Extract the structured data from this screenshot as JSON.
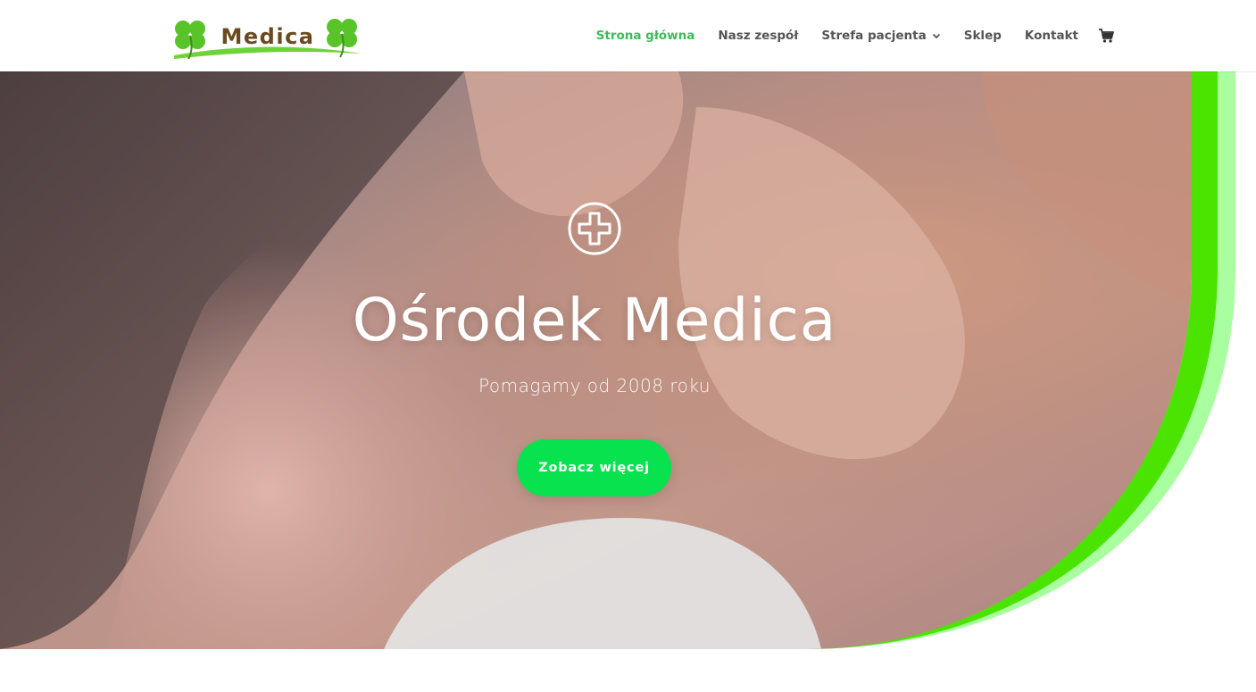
{
  "header": {
    "logo_text": "Medica",
    "nav": [
      {
        "label": "Strona główna",
        "active": true
      },
      {
        "label": "Nasz zespół",
        "active": false
      },
      {
        "label": "Strefa pacjenta",
        "active": false,
        "has_dropdown": true
      },
      {
        "label": "Sklep",
        "active": false
      },
      {
        "label": "Kontakt",
        "active": false
      }
    ],
    "cart_icon": "shopping-cart-icon"
  },
  "hero": {
    "icon": "plus-circle-icon",
    "title": "Ośrodek Medica",
    "subtitle": "Pomagamy od 2008 roku",
    "button_label": "Zobacz więcej"
  },
  "colors": {
    "nav_active": "#3fba5a",
    "nav_text": "#555555",
    "button_bg": "#08e24f",
    "accent_green": "#4be400",
    "accent_light_green": "#a9ffa0",
    "logo_text": "#6b4a1f"
  }
}
